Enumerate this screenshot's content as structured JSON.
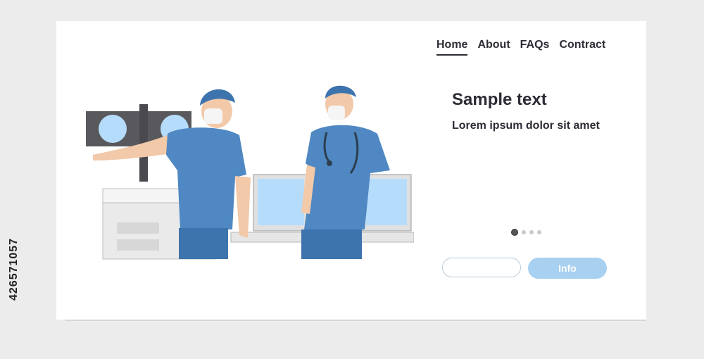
{
  "nav": {
    "items": [
      {
        "label": "Home",
        "active": true
      },
      {
        "label": "About",
        "active": false
      },
      {
        "label": "FAQs",
        "active": false
      },
      {
        "label": "Contract",
        "active": false
      }
    ]
  },
  "hero": {
    "title": "Sample text",
    "subtitle": "Lorem ipsum dolor sit amet"
  },
  "carousel": {
    "total": 4,
    "active_index": 0
  },
  "form": {
    "input_value": "",
    "button_label": "Info"
  },
  "stock_id": "426571057",
  "colors": {
    "accent": "#a8d0f0",
    "text": "#2c2c36",
    "scrubs": "#4f88c2",
    "monitor_screen": "#b6dcfb"
  }
}
